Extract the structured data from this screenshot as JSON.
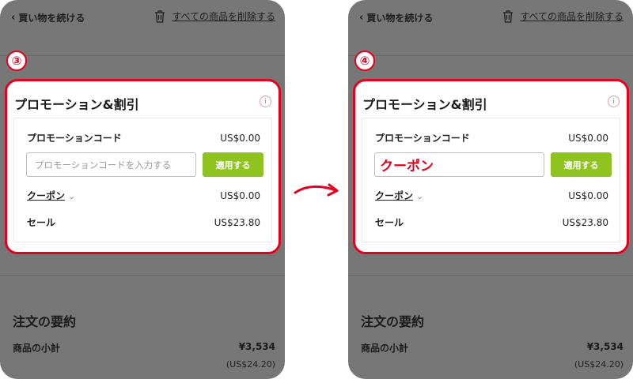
{
  "panels": [
    {
      "step": "③",
      "header": {
        "back_label": "買い物を続ける",
        "delete_label": "すべての商品を削除する"
      },
      "promo": {
        "title": "プロモーション&割引",
        "code_label": "プロモーションコード",
        "code_value": "US$0.00",
        "input_placeholder": "プロモーションコードを入力する",
        "input_value": "",
        "apply_label": "適用する",
        "coupon_label": "クーポン",
        "coupon_value": "US$0.00",
        "sale_label": "セール",
        "sale_value": "US$23.80"
      },
      "summary": {
        "title": "注文の要約",
        "subtotal_label": "商品の小計",
        "subtotal_value": "¥3,534",
        "subtotal_usd": "(US$24.20)"
      }
    },
    {
      "step": "④",
      "header": {
        "back_label": "買い物を続ける",
        "delete_label": "すべての商品を削除する"
      },
      "promo": {
        "title": "プロモーション&割引",
        "code_label": "プロモーションコード",
        "code_value": "US$0.00",
        "input_placeholder": "",
        "input_value": "クーポン",
        "apply_label": "適用する",
        "coupon_label": "クーポン",
        "coupon_value": "US$0.00",
        "sale_label": "セール",
        "sale_value": "US$23.80"
      },
      "summary": {
        "title": "注文の要約",
        "subtotal_label": "商品の小計",
        "subtotal_value": "¥3,534",
        "subtotal_usd": "(US$24.20)"
      }
    }
  ],
  "icons": {
    "back": "chevron-left-icon",
    "delete": "trash-icon",
    "info": "info-icon",
    "coupon_toggle": "chevron-down-icon",
    "transition": "arrow-right-icon"
  },
  "colors": {
    "highlight": "#e6001e",
    "apply_button": "#8fc31f",
    "overlay": "#777777"
  }
}
